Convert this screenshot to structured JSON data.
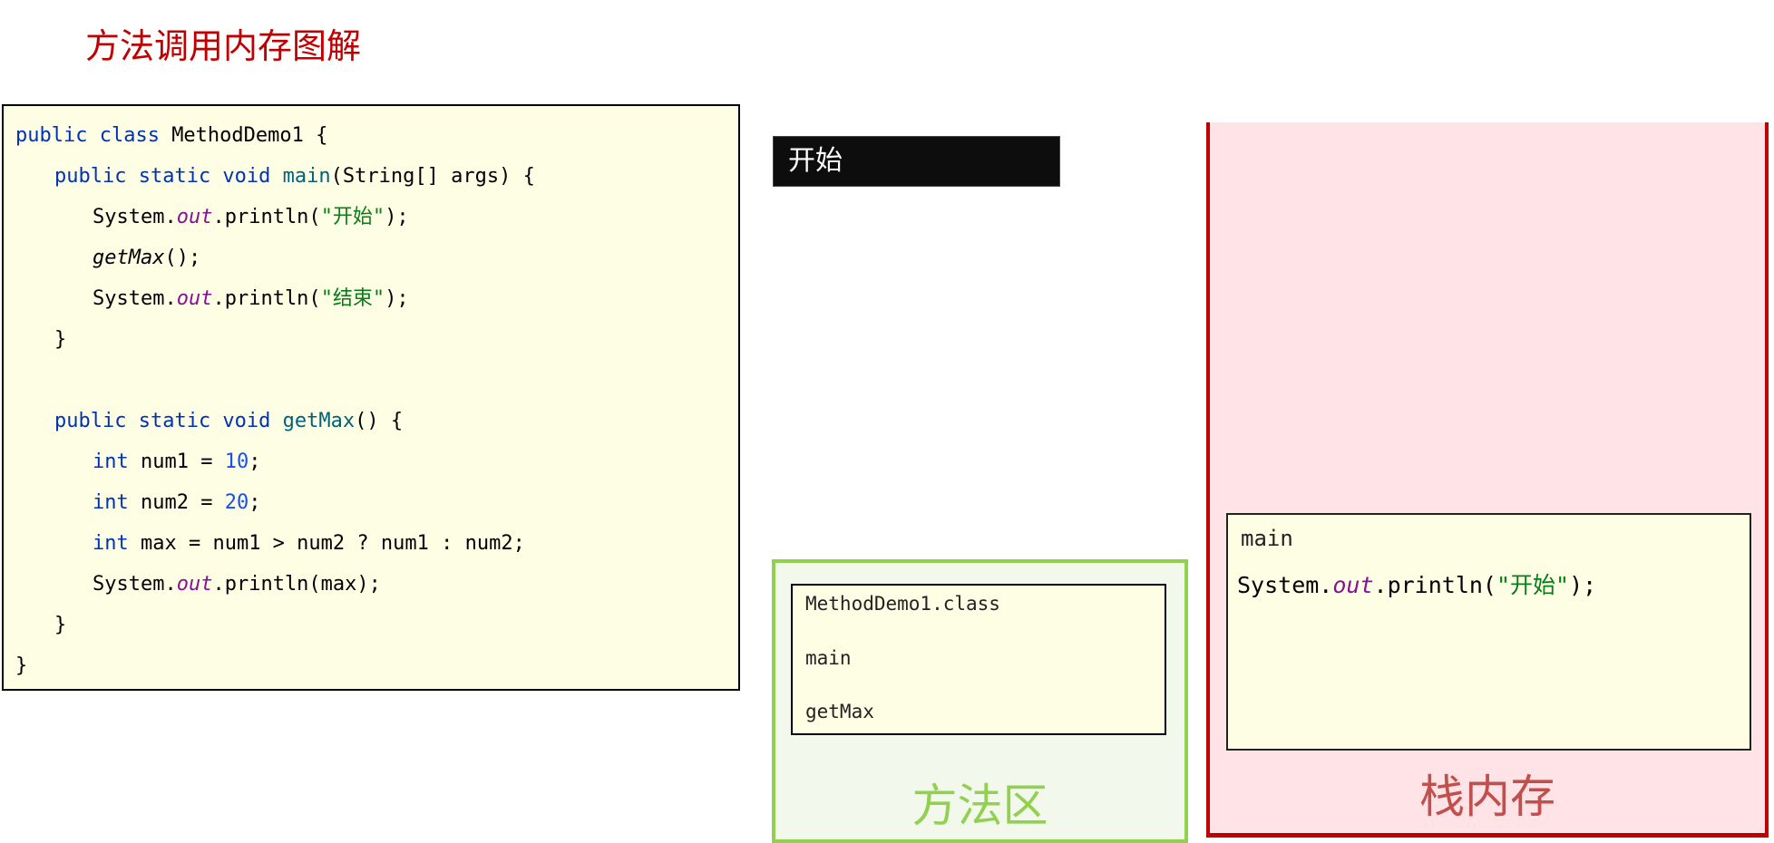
{
  "title": "方法调用内存图解",
  "code": [
    {
      "indent": 0,
      "tokens": [
        {
          "t": "public class ",
          "c": "kw"
        },
        {
          "t": "MethodDemo1 {",
          "c": ""
        }
      ]
    },
    {
      "indent": 1,
      "tokens": [
        {
          "t": "public static void ",
          "c": "kw"
        },
        {
          "t": "main",
          "c": "fn"
        },
        {
          "t": "(String[] args) {",
          "c": ""
        }
      ]
    },
    {
      "indent": 2,
      "tokens": [
        {
          "t": "System.",
          "c": ""
        },
        {
          "t": "out",
          "c": "out"
        },
        {
          "t": ".println(",
          "c": ""
        },
        {
          "t": "\"开始\"",
          "c": "str"
        },
        {
          "t": ");",
          "c": ""
        }
      ]
    },
    {
      "indent": 2,
      "tokens": [
        {
          "t": "getMax",
          "c": "it"
        },
        {
          "t": "();",
          "c": ""
        }
      ]
    },
    {
      "indent": 2,
      "tokens": [
        {
          "t": "System.",
          "c": ""
        },
        {
          "t": "out",
          "c": "out"
        },
        {
          "t": ".println(",
          "c": ""
        },
        {
          "t": "\"结束\"",
          "c": "str"
        },
        {
          "t": ");",
          "c": ""
        }
      ]
    },
    {
      "indent": 1,
      "tokens": [
        {
          "t": "}",
          "c": ""
        }
      ]
    },
    {
      "indent": 0,
      "tokens": []
    },
    {
      "indent": 1,
      "tokens": [
        {
          "t": "public static void ",
          "c": "kw"
        },
        {
          "t": "getMax",
          "c": "fn"
        },
        {
          "t": "() {",
          "c": ""
        }
      ]
    },
    {
      "indent": 2,
      "tokens": [
        {
          "t": "int ",
          "c": "kw"
        },
        {
          "t": "num1 = ",
          "c": ""
        },
        {
          "t": "10",
          "c": "num"
        },
        {
          "t": ";",
          "c": ""
        }
      ]
    },
    {
      "indent": 2,
      "tokens": [
        {
          "t": "int ",
          "c": "kw"
        },
        {
          "t": "num2 = ",
          "c": ""
        },
        {
          "t": "20",
          "c": "num"
        },
        {
          "t": ";",
          "c": ""
        }
      ]
    },
    {
      "indent": 2,
      "tokens": [
        {
          "t": "int ",
          "c": "kw"
        },
        {
          "t": "max = num1 > num2 ? num1 : num2;",
          "c": ""
        }
      ]
    },
    {
      "indent": 2,
      "tokens": [
        {
          "t": "System.",
          "c": ""
        },
        {
          "t": "out",
          "c": "out"
        },
        {
          "t": ".println(max);",
          "c": ""
        }
      ]
    },
    {
      "indent": 1,
      "tokens": [
        {
          "t": "}",
          "c": ""
        }
      ]
    },
    {
      "indent": 0,
      "tokens": [
        {
          "t": "}",
          "c": ""
        }
      ]
    }
  ],
  "console": {
    "output": "开始"
  },
  "method_area": {
    "items": [
      "MethodDemo1.class",
      "main",
      "getMax"
    ],
    "label": "方法区",
    "color": "#92d050"
  },
  "stack": {
    "frame": {
      "name": "main",
      "statement": [
        {
          "t": "System.",
          "c": ""
        },
        {
          "t": "out",
          "c": "out"
        },
        {
          "t": ".println(",
          "c": ""
        },
        {
          "t": "\"开始\"",
          "c": "str"
        },
        {
          "t": ");",
          "c": ""
        }
      ]
    },
    "label": "栈内存",
    "color": "#c00000"
  }
}
